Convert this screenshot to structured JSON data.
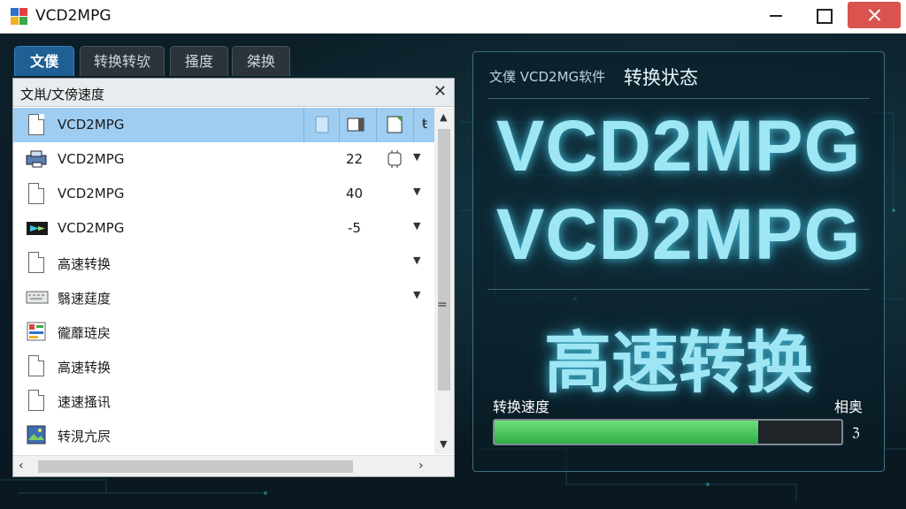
{
  "window": {
    "title": "VCD2MPG"
  },
  "tabs": [
    {
      "label": "文僕",
      "active": true
    },
    {
      "label": "转换转欤",
      "active": false
    },
    {
      "label": "搔度",
      "active": false
    },
    {
      "label": "桀换",
      "active": false
    }
  ],
  "file_panel": {
    "title": "文鼡/文傍速度",
    "rows": [
      {
        "name": "VCD2MPG",
        "value": "",
        "icon": "document-icon",
        "selected": true
      },
      {
        "name": "VCD2MPG",
        "value": "22",
        "icon": "printer-icon",
        "selected": false
      },
      {
        "name": "VCD2MPG",
        "value": "40",
        "icon": "document-icon",
        "selected": false
      },
      {
        "name": "VCD2MPG",
        "value": "-5",
        "icon": "media-icon",
        "selected": false
      },
      {
        "name": "高速转换",
        "value": "",
        "icon": "document-icon",
        "selected": false
      },
      {
        "name": "翳速莛度",
        "value": "",
        "icon": "keyboard-icon",
        "selected": false
      },
      {
        "name": "徿蘼琏戻",
        "value": "",
        "icon": "form-icon",
        "selected": false
      },
      {
        "name": "高速转换",
        "value": "",
        "icon": "document-icon",
        "selected": false
      },
      {
        "name": "速速搔讯",
        "value": "",
        "icon": "document-icon",
        "selected": false
      },
      {
        "name": "转涀亢屄",
        "value": "",
        "icon": "image-icon",
        "selected": false
      }
    ],
    "selected_row_cell": "ŧ"
  },
  "status_panel": {
    "subtitle": "文僕 VCD2MG软件",
    "title": "转换状态",
    "headline_1": "VCD2MPG",
    "headline_2": "VCD2MPG",
    "headline_3": "高速转换",
    "speed_label": "转换速度",
    "speed_right_label": "相奥",
    "progress": 0.76,
    "progress_text": "ℨ"
  },
  "colors": {
    "accent": "#1f5f93",
    "selected_row": "#9fcdf2",
    "progress_green": "#2fae47",
    "glow_text": "#9fe6f5",
    "close_button": "#d9534f"
  }
}
